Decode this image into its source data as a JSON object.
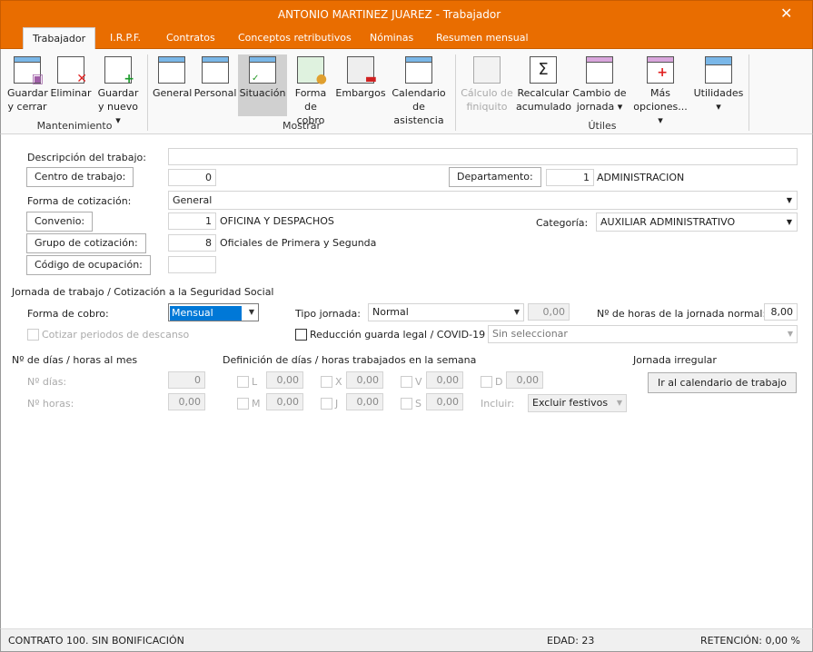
{
  "window": {
    "title": "ANTONIO MARTINEZ JUAREZ - Trabajador",
    "close_icon": "close-icon"
  },
  "tabs": [
    {
      "label": "Trabajador",
      "active": true
    },
    {
      "label": "I.R.P.F."
    },
    {
      "label": "Contratos"
    },
    {
      "label": "Conceptos retributivos"
    },
    {
      "label": "Nóminas"
    },
    {
      "label": "Resumen mensual"
    }
  ],
  "ribbon": {
    "groups": {
      "mantenimiento": "Mantenimiento",
      "mostrar": "Mostrar",
      "utiles": "Útiles"
    },
    "buttons": {
      "guardar_cerrar": [
        "Guardar",
        "y cerrar"
      ],
      "eliminar": [
        "Eliminar",
        ""
      ],
      "guardar_nuevo": [
        "Guardar",
        "y nuevo ▾"
      ],
      "general": [
        "General",
        ""
      ],
      "personal": [
        "Personal",
        ""
      ],
      "situacion": [
        "Situación",
        ""
      ],
      "forma_cobro": [
        "Forma",
        "de cobro"
      ],
      "embargos": [
        "Embargos",
        ""
      ],
      "calendario": [
        "Calendario",
        "de asistencia"
      ],
      "finiquito": [
        "Cálculo de",
        "finiquito"
      ],
      "recalcular": [
        "Recalcular",
        "acumulado"
      ],
      "cambio_jornada": [
        "Cambio de",
        "jornada ▾"
      ],
      "mas_opciones": [
        "Más",
        "opciones... ▾"
      ],
      "utilidades": [
        "Utilidades",
        "▾"
      ]
    }
  },
  "form": {
    "descripcion_label": "Descripción del trabajo:",
    "descripcion_value": "",
    "centro_label": "Centro de trabajo:",
    "centro_value": "0",
    "departamento_label": "Departamento:",
    "departamento_value": "1",
    "departamento_name": "ADMINISTRACION",
    "forma_cotizacion_label": "Forma de cotización:",
    "forma_cotizacion_value": "General",
    "convenio_label": "Convenio:",
    "convenio_value": "1",
    "convenio_name": "OFICINA Y DESPACHOS",
    "categoria_label": "Categoría:",
    "categoria_value": "AUXILIAR ADMINISTRATIVO",
    "grupo_label": "Grupo de cotización:",
    "grupo_value": "8",
    "grupo_name": "Oficiales de Primera y Segunda",
    "codigo_label": "Código de ocupación:",
    "codigo_value": ""
  },
  "jornada": {
    "section_title": "Jornada de trabajo / Cotización a la Seguridad Social",
    "forma_cobro_label": "Forma de cobro:",
    "forma_cobro_value": "Mensual",
    "tipo_jornada_label": "Tipo jornada:",
    "tipo_jornada_value": "Normal",
    "tipo_jornada_pct": "0,00",
    "horas_normal_label": "Nº de horas de la jornada normal:",
    "horas_normal_value": "8,00",
    "cotizar_label": "Cotizar periodos de descanso",
    "reduccion_label": "Reducción guarda legal / COVID-19",
    "reduccion_value": "Sin seleccionar"
  },
  "mes": {
    "title": "Nº de días / horas al mes",
    "dias_label": "Nº días:",
    "dias_value": "0",
    "horas_label": "Nº horas:",
    "horas_value": "0,00"
  },
  "semana": {
    "title": "Definición de días / horas trabajados en la semana",
    "days": [
      {
        "d": "L",
        "v": "0,00"
      },
      {
        "d": "M",
        "v": "0,00"
      },
      {
        "d": "X",
        "v": "0,00"
      },
      {
        "d": "J",
        "v": "0,00"
      },
      {
        "d": "V",
        "v": "0,00"
      },
      {
        "d": "S",
        "v": "0,00"
      },
      {
        "d": "D",
        "v": "0,00"
      }
    ],
    "incluir_label": "Incluir:",
    "incluir_value": "Excluir festivos"
  },
  "irregular": {
    "title": "Jornada irregular",
    "button": "Ir al calendario de trabajo"
  },
  "status": {
    "contrato": "CONTRATO 100.  SIN BONIFICACIÓN",
    "edad": "EDAD: 23",
    "retencion": "RETENCIÓN: 0,00 %"
  },
  "colors": {
    "accent": "#E96D00",
    "selection": "#0078D7"
  }
}
